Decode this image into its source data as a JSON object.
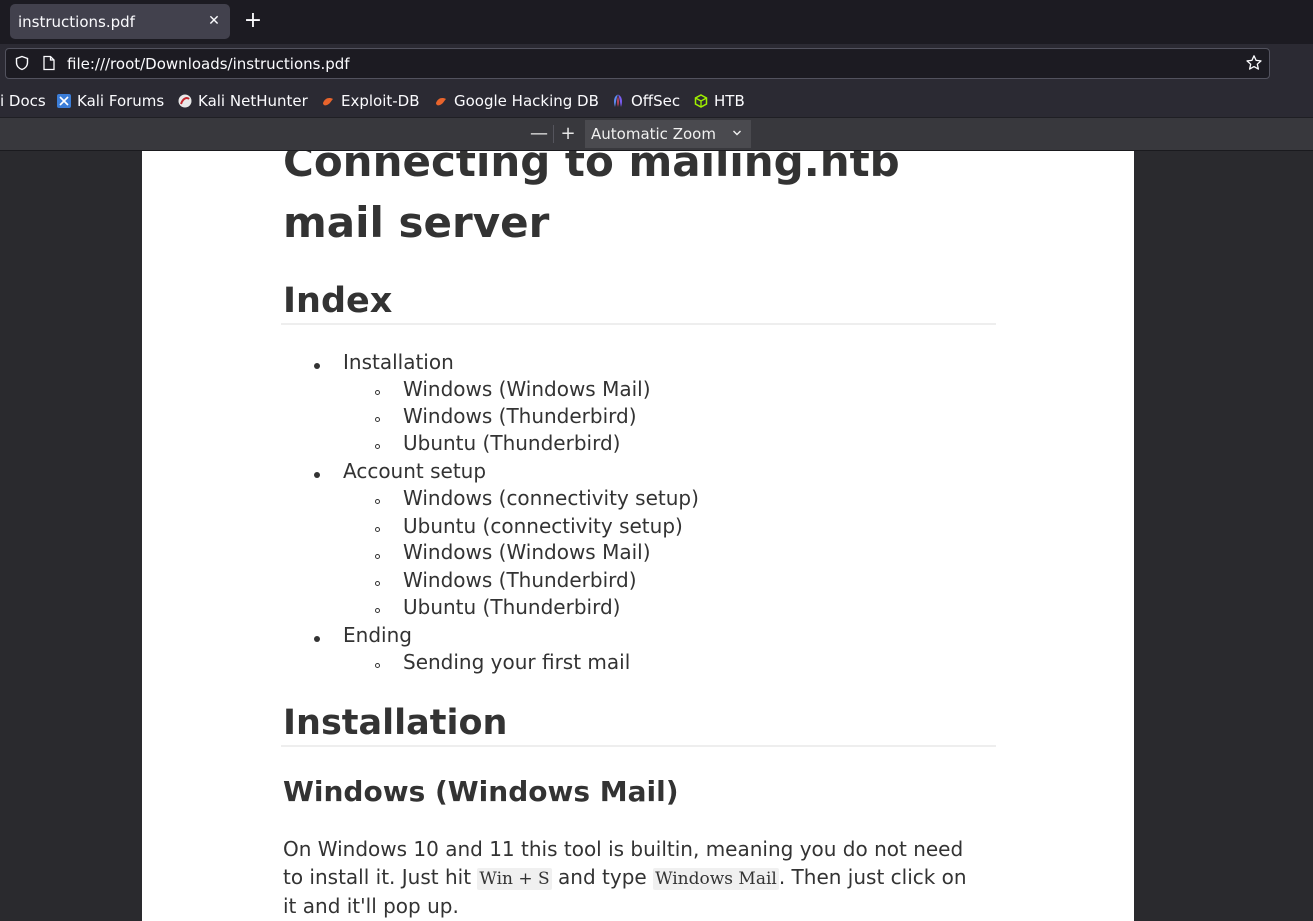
{
  "browser": {
    "tab": {
      "title": "instructions.pdf",
      "close": "✕"
    },
    "new_tab": "+",
    "url": "file:///root/Downloads/instructions.pdf",
    "bookmarks": [
      {
        "label": "i Docs",
        "icon": "kali-docs-icon"
      },
      {
        "label": "Kali Forums",
        "icon": "kali-forums-icon"
      },
      {
        "label": "Kali NetHunter",
        "icon": "kali-nethunter-icon"
      },
      {
        "label": "Exploit-DB",
        "icon": "exploit-db-icon"
      },
      {
        "label": "Google Hacking DB",
        "icon": "ghdb-icon"
      },
      {
        "label": "OffSec",
        "icon": "offsec-icon"
      },
      {
        "label": "HTB",
        "icon": "htb-icon"
      }
    ]
  },
  "pdf_toolbar": {
    "zoom_out": "—",
    "zoom_in": "+",
    "zoom_value": "Automatic Zoom"
  },
  "document": {
    "title": "Connecting to mailing.htb mail server",
    "index_heading": "Index",
    "index": {
      "installation": "Installation",
      "installation_items": [
        "Windows (Windows Mail)",
        "Windows (Thunderbird)",
        "Ubuntu (Thunderbird)"
      ],
      "account_setup": "Account setup",
      "account_setup_items": [
        "Windows (connectivity setup)",
        "Ubuntu (connectivity setup)",
        "Windows (Windows Mail)",
        "Windows (Thunderbird)",
        "Ubuntu (Thunderbird)"
      ],
      "ending": "Ending",
      "ending_items": [
        "Sending your first mail"
      ]
    },
    "installation_heading": "Installation",
    "windows_mail_heading": "Windows (Windows Mail)",
    "paragraph": {
      "part1": "On Windows 10 and 11 this tool is builtin, meaning you do not need to install it. Just hit ",
      "kbd1": "Win + S",
      "part2": " and type ",
      "kbd2": "Windows Mail",
      "part3": ". Then just click on it and it'll pop up."
    }
  }
}
